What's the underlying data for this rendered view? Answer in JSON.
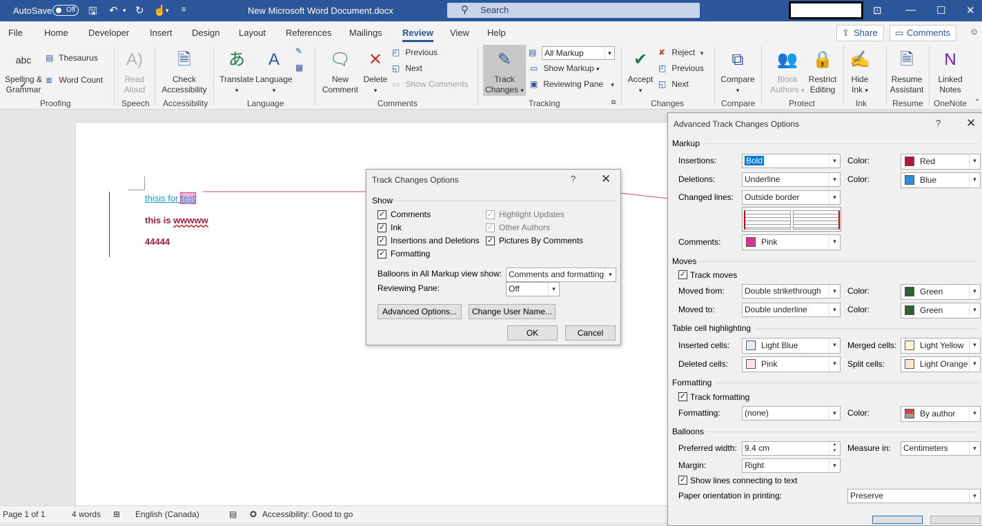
{
  "titlebar": {
    "autosave_label": "AutoSave",
    "autosave_state": "Off",
    "doc_title": "New Microsoft Word Document.docx",
    "search_placeholder": "Search"
  },
  "tabs": [
    "File",
    "Home",
    "Developer",
    "Insert",
    "Design",
    "Layout",
    "References",
    "Mailings",
    "Review",
    "View",
    "Help"
  ],
  "active_tab": "Review",
  "share_label": "Share",
  "comments_label": "Comments",
  "ribbon": {
    "proofing": {
      "spelling_l1": "Spelling &",
      "spelling_l2": "Grammar",
      "thesaurus": "Thesaurus",
      "word_count": "Word Count",
      "group": "Proofing"
    },
    "speech": {
      "read_l1": "Read",
      "read_l2": "Aloud",
      "group": "Speech"
    },
    "accessibility": {
      "check_l1": "Check",
      "check_l2": "Accessibility",
      "group": "Accessibility"
    },
    "language": {
      "translate": "Translate",
      "language": "Language",
      "group": "Language"
    },
    "comments": {
      "new_l1": "New",
      "new_l2": "Comment",
      "delete": "Delete",
      "previous": "Previous",
      "next": "Next",
      "show_comments": "Show Comments",
      "group": "Comments"
    },
    "tracking": {
      "track_l1": "Track",
      "track_l2": "Changes",
      "markup": "All Markup",
      "show_markup": "Show Markup",
      "reviewing_pane": "Reviewing Pane",
      "group": "Tracking"
    },
    "changes": {
      "accept": "Accept",
      "reject": "Reject",
      "previous": "Previous",
      "next": "Next",
      "group": "Changes"
    },
    "compare": {
      "compare": "Compare",
      "group": "Compare"
    },
    "protect": {
      "block_l1": "Block",
      "block_l2": "Authors",
      "restrict_l1": "Restrict",
      "restrict_l2": "Editing",
      "group": "Protect"
    },
    "ink": {
      "hide_l1": "Hide",
      "hide_l2": "Ink",
      "group": "Ink"
    },
    "resume": {
      "resume_l1": "Resume",
      "resume_l2": "Assistant",
      "group": "Resume"
    },
    "onenote": {
      "linked_l1": "Linked",
      "linked_l2": "Notes",
      "group": "OneNote"
    }
  },
  "document": {
    "line1_a": "thisis for ",
    "line1_b": "test",
    "line2_a": "this is ",
    "line2_b": "wwwww",
    "line3": "44444"
  },
  "status": {
    "page": "Page 1 of 1",
    "words": "4 words",
    "language": "English (Canada)",
    "accessibility": "Accessibility: Good to go"
  },
  "track_dialog": {
    "title": "Track Changes Options",
    "show_heading": "Show",
    "checks": [
      {
        "label": "Comments",
        "checked": true,
        "enabled": true
      },
      {
        "label": "Ink",
        "checked": true,
        "enabled": true
      },
      {
        "label": "Insertions and Deletions",
        "checked": true,
        "enabled": true
      },
      {
        "label": "Formatting",
        "checked": true,
        "enabled": true
      },
      {
        "label": "Highlight Updates",
        "checked": true,
        "enabled": false
      },
      {
        "label": "Other Authors",
        "checked": true,
        "enabled": false
      },
      {
        "label": "Pictures By Comments",
        "checked": true,
        "enabled": true
      }
    ],
    "balloons_label": "Balloons in All Markup view show:",
    "balloons_value": "Comments and formatting",
    "pane_label": "Reviewing Pane:",
    "pane_value": "Off",
    "advanced_btn": "Advanced Options...",
    "username_btn": "Change User Name...",
    "ok": "OK",
    "cancel": "Cancel"
  },
  "adv_dialog": {
    "title": "Advanced Track Changes Options",
    "markup_heading": "Markup",
    "insertions_label": "Insertions:",
    "insertions_value": "Bold",
    "deletions_label": "Deletions:",
    "deletions_value": "Underline",
    "changed_lines_label": "Changed lines:",
    "changed_lines_value": "Outside border",
    "comments_label": "Comments:",
    "comments_value": "Pink",
    "color_label": "Color:",
    "ins_color": "Red",
    "del_color": "Blue",
    "moves_heading": "Moves",
    "track_moves": "Track moves",
    "moved_from_label": "Moved from:",
    "moved_from_value": "Double strikethrough",
    "moved_to_label": "Moved to:",
    "moved_to_value": "Double underline",
    "from_color": "Green",
    "to_color": "Green",
    "table_heading": "Table cell highlighting",
    "inserted_cells_label": "Inserted cells:",
    "inserted_cells_value": "Light Blue",
    "deleted_cells_label": "Deleted cells:",
    "deleted_cells_value": "Pink",
    "merged_cells_label": "Merged cells:",
    "merged_cells_value": "Light Yellow",
    "split_cells_label": "Split cells:",
    "split_cells_value": "Light Orange",
    "formatting_heading": "Formatting",
    "track_formatting": "Track formatting",
    "formatting_label": "Formatting:",
    "formatting_value": "(none)",
    "fmt_color": "By author",
    "balloons_heading": "Balloons",
    "pref_width_label": "Preferred width:",
    "pref_width_value": "9.4 cm",
    "measure_label": "Measure in:",
    "measure_value": "Centimeters",
    "margin_label": "Margin:",
    "margin_value": "Right",
    "show_lines": "Show lines connecting to text",
    "paper_label": "Paper orientation in printing:",
    "paper_value": "Preserve"
  },
  "swatch_colors": {
    "red": "#b5163f",
    "blue": "#2e8fd6",
    "pink": "#d9348f",
    "green": "#2f5f33",
    "light_blue": "#e1edf8",
    "light_pink": "#fbe3ea",
    "light_yellow": "#fdf2d6",
    "light_orange": "#fde5d4",
    "by_author_top": "#e04040",
    "by_author_bottom": "#9a9a9a"
  }
}
